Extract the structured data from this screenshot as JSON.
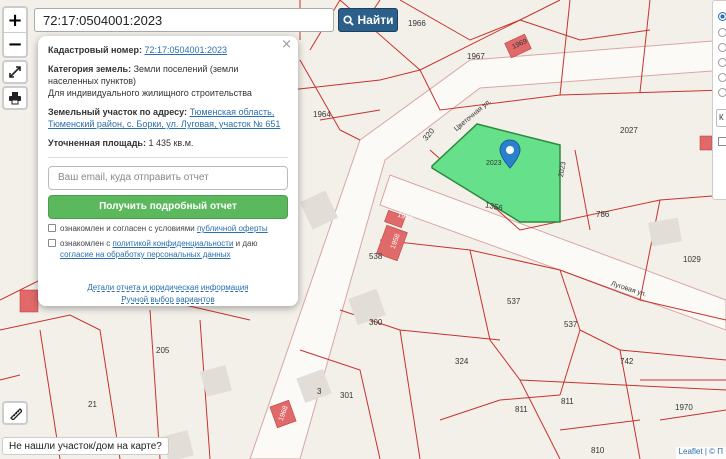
{
  "search": {
    "value": "72:17:0504001:2023",
    "button_label": "Найти"
  },
  "zoom": {
    "in_label": "+",
    "out_label": "−"
  },
  "popup": {
    "close_label": "×",
    "cadastral_label": "Кадастровый номер:",
    "cadastral_value": "72:17:0504001:2023",
    "category_label": "Категория земель:",
    "category_value": "Земли поселений (земли населенных пунктов)",
    "usage": "Для индивидуального жилищного строительства",
    "address_label": "Земельный участок по адресу:",
    "address_value": "Тюменская область, Тюменский район, с. Борки, ул. Луговая, участок № 651",
    "area_label": "Уточненная площадь:",
    "area_value": "1 435 кв.м.",
    "email_placeholder": "Ваш email, куда отправить отчет",
    "report_button": "Получить подробный отчет",
    "consent1_prefix": "ознакомлен и согласен с условиями",
    "consent1_link": "публичной оферты",
    "consent2_prefix": "ознакомлен с",
    "consent2_link1": "политикой конфиденциальности",
    "consent2_mid": "и даю",
    "consent2_link2": "согласие на обработку персональных данных",
    "details_link": "Детали отчета и юридическая информация",
    "manual_link": "Ручной выбор вариантов"
  },
  "bottom_link": "Не нашли участок/дом на карте?",
  "attribution": "Leaflet | © П",
  "right_panel_input": "К",
  "map_labels": {
    "l1966": "1966",
    "l1967": "1967",
    "l1969": "1969",
    "l1964": "1964",
    "l2027": "2027",
    "l320": "320",
    "l2023a": "2023",
    "l2023b": "2023",
    "l1356": "1356",
    "l786": "786",
    "l1957": "1957",
    "l1958": "1958",
    "l538": "538",
    "l1029": "1029",
    "l537a": "537",
    "l537b": "537",
    "l300": "300",
    "l205": "205",
    "l324": "324",
    "l742": "742",
    "l3": "3",
    "l301": "301",
    "l811a": "811",
    "l811b": "811",
    "l21": "21",
    "l1970": "1970",
    "l810": "810",
    "l1968": "1968",
    "street1": "Цветочная ул.",
    "street2": "Луговая ул."
  },
  "colors": {
    "parcel_line": "#c8322d",
    "selected_fill": "#66e08a",
    "marker": "#2a81cb",
    "button_green": "#5cb85c",
    "search_button": "#2c5f8a"
  }
}
